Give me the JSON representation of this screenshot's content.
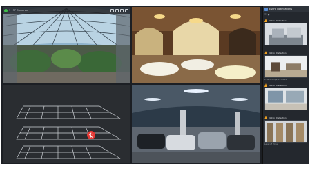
{
  "camera_toolbar": {
    "text": "1 · 37 Cameras"
  },
  "sidebar": {
    "title": "Event Notifications",
    "items": [
      {
        "title": "Motion Detection",
        "caption": ""
      },
      {
        "title": "Motion Detection",
        "caption": "2 Recordings, 12.09.18"
      },
      {
        "title": "Motion Detection",
        "caption": ""
      },
      {
        "title": "Motion Detection",
        "caption": "Level of Zone"
      }
    ]
  },
  "colors": {
    "accent": "#3fbf4a",
    "alert": "#e53935",
    "warning": "#f0a020"
  }
}
